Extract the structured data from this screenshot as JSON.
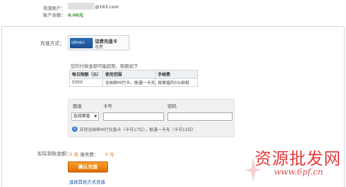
{
  "account": {
    "label": "充值账户：",
    "domain": "@163.com",
    "balance_label": "账户余额：",
    "balance_value": "0.00元"
  },
  "method": {
    "label": "充值方式：",
    "card_image_text": "话费充值卡",
    "card_name": "话费充值卡",
    "card_sub": "收费"
  },
  "limits": {
    "note": "您的付款金额可能超限，限额如下",
    "headers": [
      "每日限额（元）",
      "使用范围",
      "手续费"
    ],
    "rows": [
      [
        "5000",
        "全国神州行卡，联通一卡充",
        "按面值的5%收取"
      ]
    ]
  },
  "form": {
    "face_label": "面值",
    "card_label": "卡号",
    "pwd_label": "密码",
    "select_value": "选择面值",
    "hint": "支持全国神州行充值卡（卡号17位），联通一卡充（卡号15位）"
  },
  "amount": {
    "label": "实际到账金额：",
    "value": "0 元",
    "sep": "|",
    "fee_label": "服务费：",
    "fee_value": "0 元"
  },
  "actions": {
    "confirm_label": "确认充值",
    "other_link": "选择其他方式充值"
  },
  "watermark": {
    "main": "资源批发网",
    "url": "www.6pf.cn"
  },
  "colors": {
    "accent_orange": "#e06a00",
    "balance_green": "#2e8b2e",
    "link_blue": "#1a57a8",
    "watermark_red": "#e33a3a"
  }
}
